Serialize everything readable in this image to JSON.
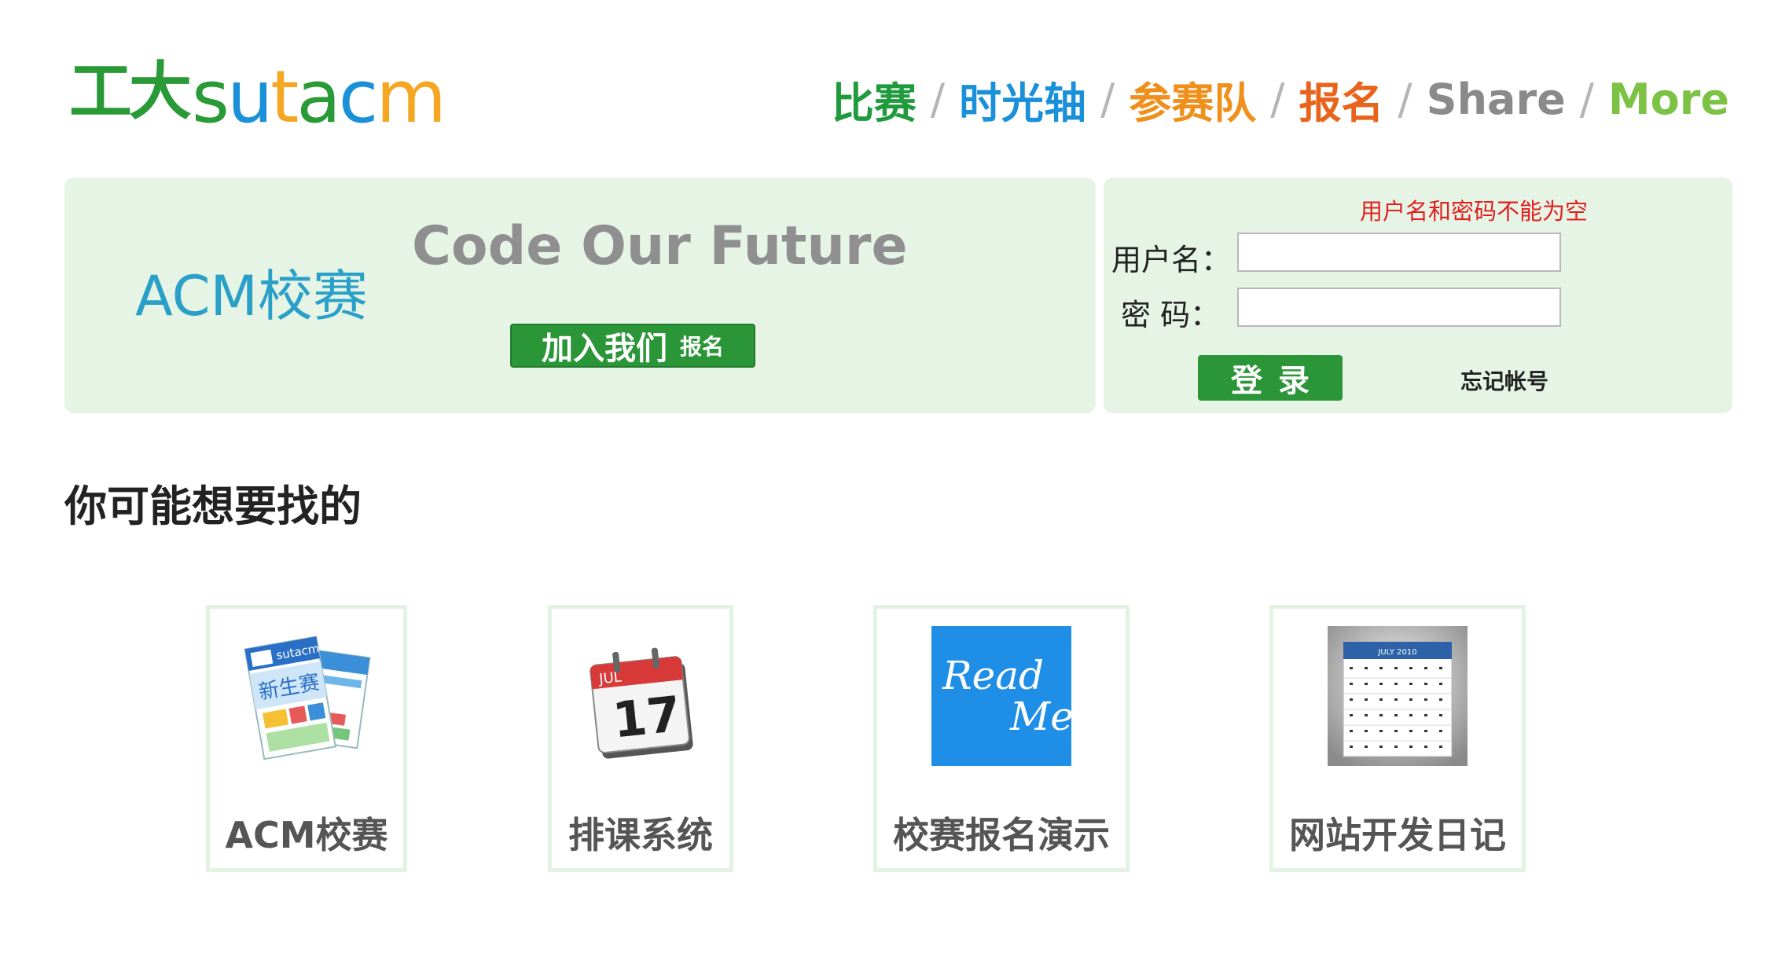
{
  "logo": {
    "cn": "工大",
    "en_letters": [
      {
        "ch": "s",
        "color": "#2a9a37"
      },
      {
        "ch": "u",
        "color": "#1a90d8"
      },
      {
        "ch": "t",
        "color": "#f5a623"
      },
      {
        "ch": "a",
        "color": "#2a9a37"
      },
      {
        "ch": "c",
        "color": "#1a90d8"
      },
      {
        "ch": "m",
        "color": "#f5a623"
      }
    ]
  },
  "nav": {
    "separator": "/",
    "items": [
      {
        "label": "比赛",
        "color": "#1f9a3c"
      },
      {
        "label": "时光轴",
        "color": "#1a90d8"
      },
      {
        "label": "参赛队",
        "color": "#f0901c"
      },
      {
        "label": "报名",
        "color": "#e8641c"
      },
      {
        "label": "Share",
        "color": "#8a8a8a"
      },
      {
        "label": "More",
        "color": "#7cc244"
      }
    ]
  },
  "hero": {
    "title": "ACM校赛",
    "slogan": "Code Our Future",
    "join_label": "加入我们",
    "join_sub": "报名"
  },
  "login": {
    "error": "用户名和密码不能为空",
    "username_label": "用户名：",
    "password_label": "密 码：",
    "username_value": "",
    "password_value": "",
    "submit_label": "登录",
    "forgot_label": "忘记帐号"
  },
  "suggestions": {
    "heading": "你可能想要找的",
    "items": [
      {
        "label": "ACM校赛",
        "icon": "acm-poster-icon"
      },
      {
        "label": "排课系统",
        "icon": "calendar-icon"
      },
      {
        "label": "校赛报名演示",
        "icon": "readme-icon",
        "icon_text": [
          "Read",
          "Me"
        ]
      },
      {
        "label": "网站开发日记",
        "icon": "calendar-grid-icon",
        "calendar_header": "JULY 2010"
      }
    ],
    "calendar_day": "17",
    "calendar_month": "JUL",
    "poster_title": "sutacm",
    "poster_text": "新生赛"
  },
  "colors": {
    "accent_green": "#2b9638",
    "panel_bg": "#e6f4e6",
    "error_red": "#e02020"
  }
}
